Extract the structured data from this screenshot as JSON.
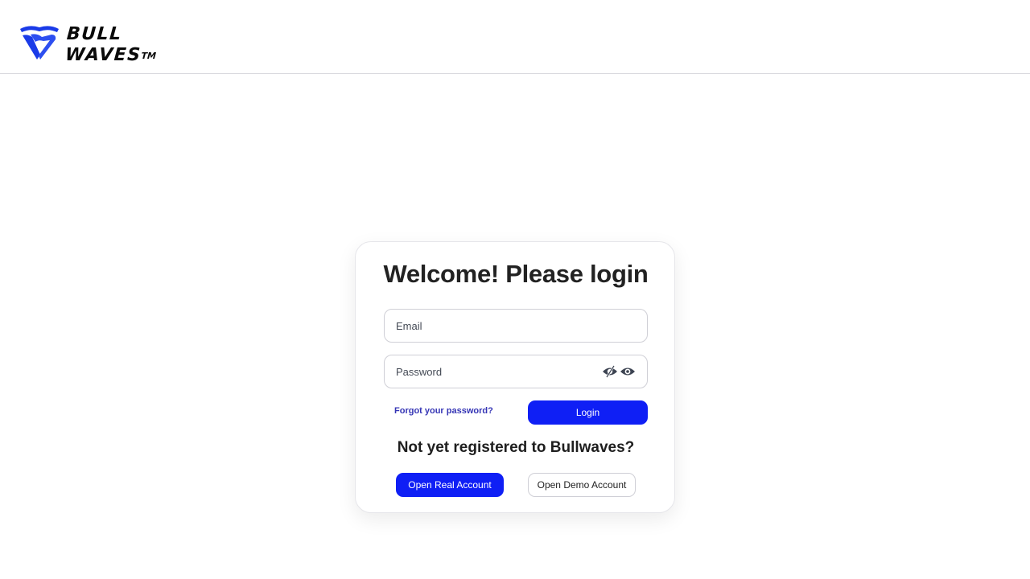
{
  "header": {
    "logo": {
      "line1": "BULL",
      "line2": "WAVES",
      "trademark": "TM",
      "icon": "bullwaves-logo-icon",
      "color": "#1a3be8"
    }
  },
  "login_card": {
    "title": "Welcome! Please login",
    "email": {
      "placeholder": "Email",
      "value": ""
    },
    "password": {
      "placeholder": "Password",
      "value": "",
      "icons": [
        "eye-slash-icon",
        "eye-icon"
      ]
    },
    "forgot_link": "Forgot your password?",
    "login_button": "Login",
    "register_prompt": "Not yet registered to Bullwaves?",
    "open_real_button": "Open Real Account",
    "open_demo_button": "Open Demo Account"
  },
  "colors": {
    "primary": "#0f1ff5",
    "link": "#3535b5",
    "text": "#222222",
    "border": "#cfcfd6"
  }
}
